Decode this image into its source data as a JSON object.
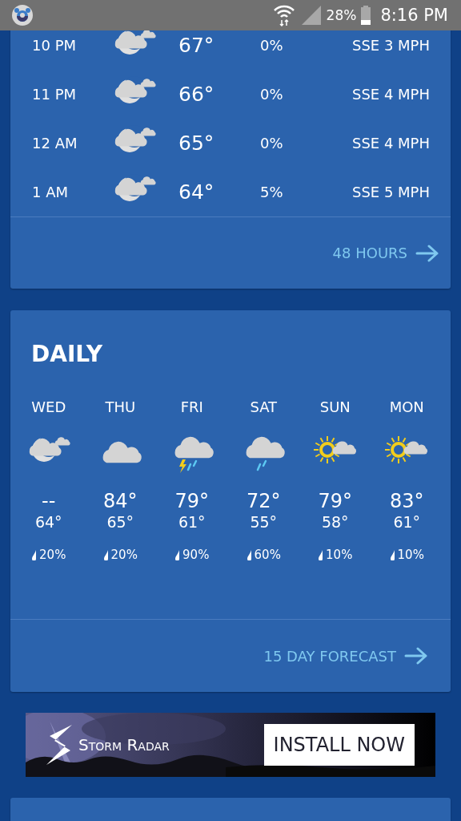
{
  "status_bar": {
    "battery": "28%",
    "time": "8:16 PM"
  },
  "hourly": {
    "rows": [
      {
        "time": "10 PM",
        "kind": "night-partly-cloudy",
        "temp": "67°",
        "precip": "0%",
        "wind": "SSE 3 MPH"
      },
      {
        "time": "11 PM",
        "kind": "night-partly-cloudy",
        "temp": "66°",
        "precip": "0%",
        "wind": "SSE 4 MPH"
      },
      {
        "time": "12 AM",
        "kind": "night-partly-cloudy",
        "temp": "65°",
        "precip": "0%",
        "wind": "SSE 4 MPH"
      },
      {
        "time": "1 AM",
        "kind": "night-partly-cloudy",
        "temp": "64°",
        "precip": "5%",
        "wind": "SSE 5 MPH"
      }
    ],
    "link": "48 HOURS"
  },
  "daily": {
    "title": "DAILY",
    "days": [
      {
        "day": "WED",
        "kind": "night-partly-cloudy",
        "high": "--",
        "low": "64°",
        "precip": "20%"
      },
      {
        "day": "THU",
        "kind": "cloudy",
        "high": "84°",
        "low": "65°",
        "precip": "20%"
      },
      {
        "day": "FRI",
        "kind": "thunderstorm",
        "high": "79°",
        "low": "61°",
        "precip": "90%"
      },
      {
        "day": "SAT",
        "kind": "rain",
        "high": "72°",
        "low": "55°",
        "precip": "60%"
      },
      {
        "day": "SUN",
        "kind": "partly-sunny",
        "high": "79°",
        "low": "58°",
        "precip": "10%"
      },
      {
        "day": "MON",
        "kind": "partly-sunny",
        "high": "83°",
        "low": "61°",
        "precip": "10%"
      }
    ],
    "link": "15 DAY FORECAST"
  },
  "ad": {
    "brand": "Storm Radar",
    "button": "INSTALL NOW"
  }
}
